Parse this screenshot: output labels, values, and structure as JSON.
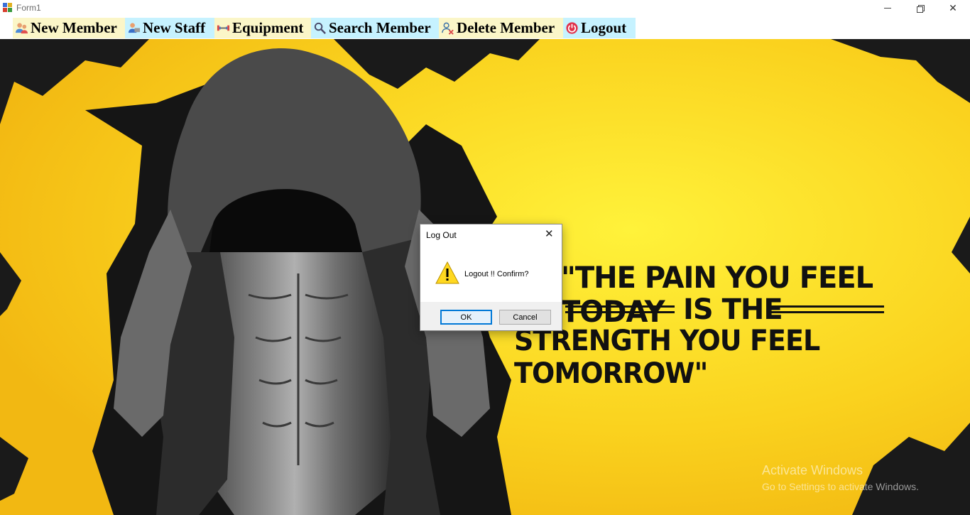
{
  "window": {
    "title": "Form1",
    "close_glyph": "✕"
  },
  "menu": {
    "items": [
      {
        "label": "New Member",
        "icon": "users-icon"
      },
      {
        "label": "New Staff",
        "icon": "staff-icon"
      },
      {
        "label": "Equipment",
        "icon": "dumbbell-icon"
      },
      {
        "label": "Search Member",
        "icon": "search-icon"
      },
      {
        "label": "Delete Member",
        "icon": "user-remove-icon"
      },
      {
        "label": "Logout",
        "icon": "power-icon"
      }
    ],
    "colors": {
      "yellow": "#fbf6c8",
      "cyan": "#c6f2ff"
    }
  },
  "background": {
    "quote_line1": "\"THE PAIN YOU FEEL TODAY",
    "quote_line2": "IS THE",
    "quote_line3": "STRENGTH YOU FEEL TOMORROW\"",
    "colors": {
      "yellow": "#f7c21c",
      "ink": "#111111"
    }
  },
  "dialog": {
    "title": "Log Out",
    "close_glyph": "✕",
    "icon": "warning-icon",
    "message": "Logout !! Confirm?",
    "ok_label": "OK",
    "cancel_label": "Cancel"
  },
  "watermark": {
    "line1": "Activate Windows",
    "line2": "Go to Settings to activate Windows."
  }
}
